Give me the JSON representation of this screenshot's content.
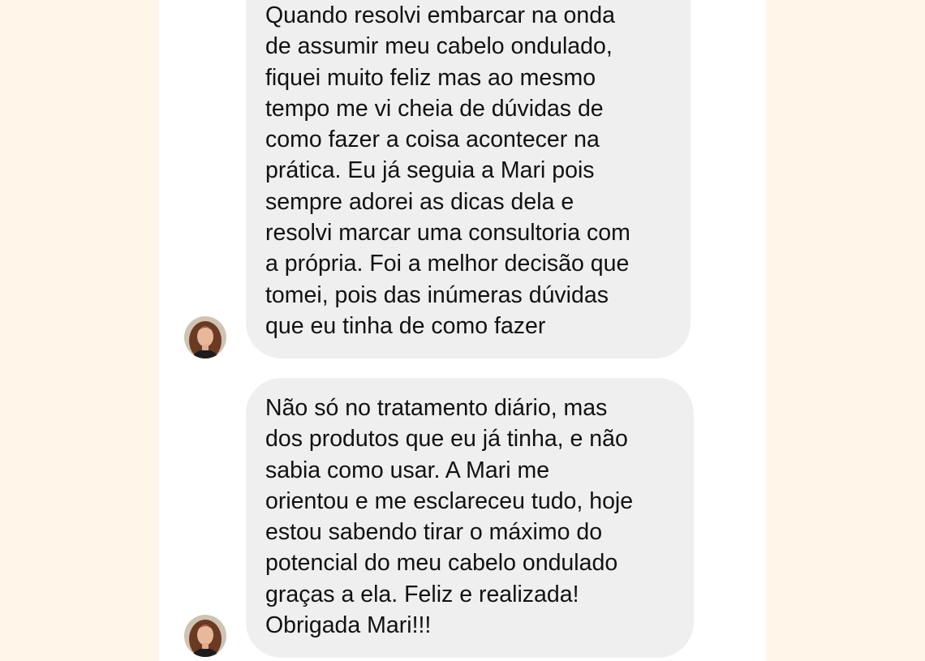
{
  "chat": {
    "messages": [
      {
        "sender_avatar": "woman-portrait-avatar",
        "lines": [
          "Quando resolvi embarcar na onda",
          "de assumir meu cabelo ondulado,",
          "fiquei muito feliz mas ao mesmo",
          "tempo me vi cheia de dúvidas de",
          "como fazer a coisa acontecer na",
          "prática.  Eu já seguia a Mari pois",
          "sempre adorei as dicas dela e",
          "resolvi marcar uma consultoria com",
          "a própria.  Foi a melhor decisão que",
          "tomei,  pois das inúmeras dúvidas",
          "que eu tinha de como fazer"
        ]
      },
      {
        "sender_avatar": "woman-portrait-avatar",
        "lines": [
          "Não só no tratamento diário,  mas",
          "dos produtos que eu já tinha, e não",
          "sabia como usar.  A Mari me",
          "orientou e me esclareceu tudo, hoje",
          "estou sabendo tirar o máximo do",
          "potencial do meu cabelo ondulado",
          "graças a ela.  Feliz e realizada!",
          "Obrigada Mari!!!"
        ]
      }
    ]
  },
  "colors": {
    "page_background": "#fff5e9",
    "panel_background": "#ffffff",
    "bubble_background": "#efefef",
    "text": "#111111"
  }
}
